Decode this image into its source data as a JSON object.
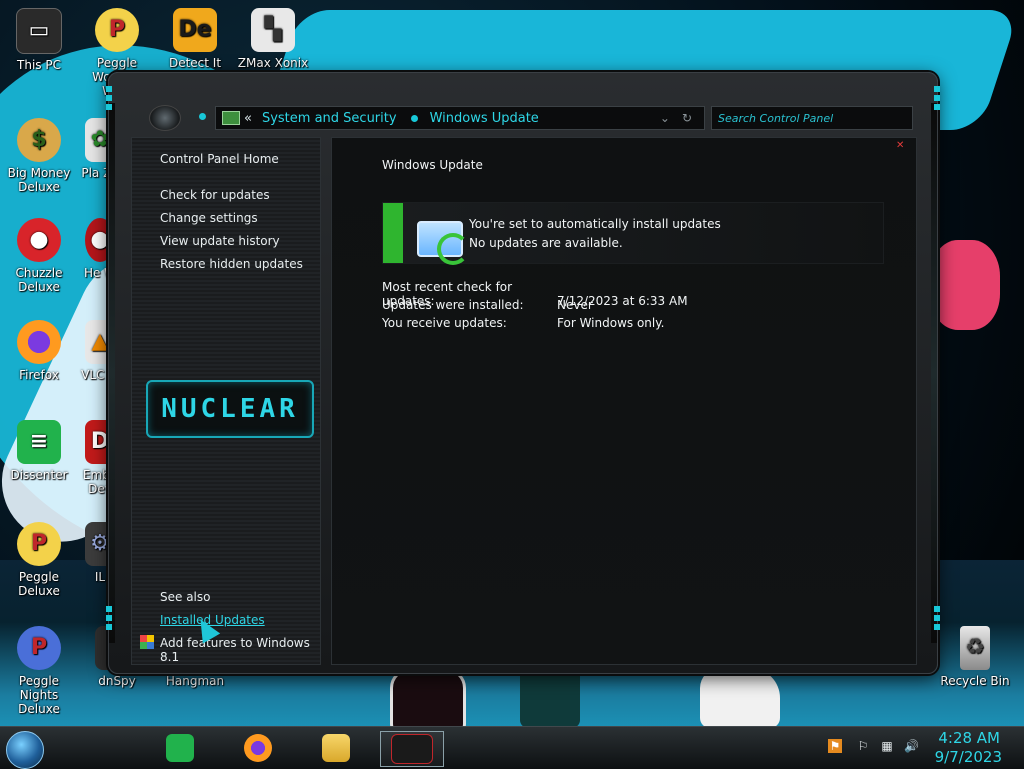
{
  "desktop": {
    "icons": [
      {
        "label": "This PC"
      },
      {
        "label": "Peggle World of Wo..."
      },
      {
        "label": "Detect It Easy"
      },
      {
        "label": "ZMax Xonix"
      },
      {
        "label": "Big Money Deluxe"
      },
      {
        "label": "Pla Zo"
      },
      {
        "label": "Chuzzle Deluxe"
      },
      {
        "label": "He W"
      },
      {
        "label": "Firefox"
      },
      {
        "label": "VLC Pl"
      },
      {
        "label": "Dissenter"
      },
      {
        "label": "Emba Dev"
      },
      {
        "label": "Peggle Deluxe"
      },
      {
        "label": "IL"
      },
      {
        "label": "Peggle Nights Deluxe"
      },
      {
        "label": "dnSpy"
      },
      {
        "label": "Hangman"
      },
      {
        "label": "Recycle Bin"
      }
    ]
  },
  "window": {
    "address": {
      "separator": "«",
      "crumbs": [
        "System and Security",
        "Windows Update"
      ]
    },
    "search_placeholder": "Search Control Panel",
    "left": {
      "home": "Control Panel Home",
      "links": [
        "Check for updates",
        "Change settings",
        "View update history",
        "Restore hidden updates"
      ],
      "logo_text": "NUCLEAR",
      "see_also": "See also",
      "installed_updates": "Installed Updates",
      "add_features": "Add features to Windows 8.1"
    },
    "main": {
      "title": "Windows Update",
      "status_line1": "You're set to automatically install updates",
      "status_line2": "No updates are available.",
      "info": [
        {
          "label": "Most recent check for updates:",
          "value": "7/12/2023 at 6:33 AM"
        },
        {
          "label": "Updates were installed:",
          "value": "Never"
        },
        {
          "label": "You receive updates:",
          "value": "For Windows only."
        }
      ]
    }
  },
  "taskbar": {
    "time": "4:28 AM",
    "date": "9/7/2023"
  },
  "colors": {
    "accent": "#2ed6e6",
    "status_green": "#2fb52f"
  }
}
